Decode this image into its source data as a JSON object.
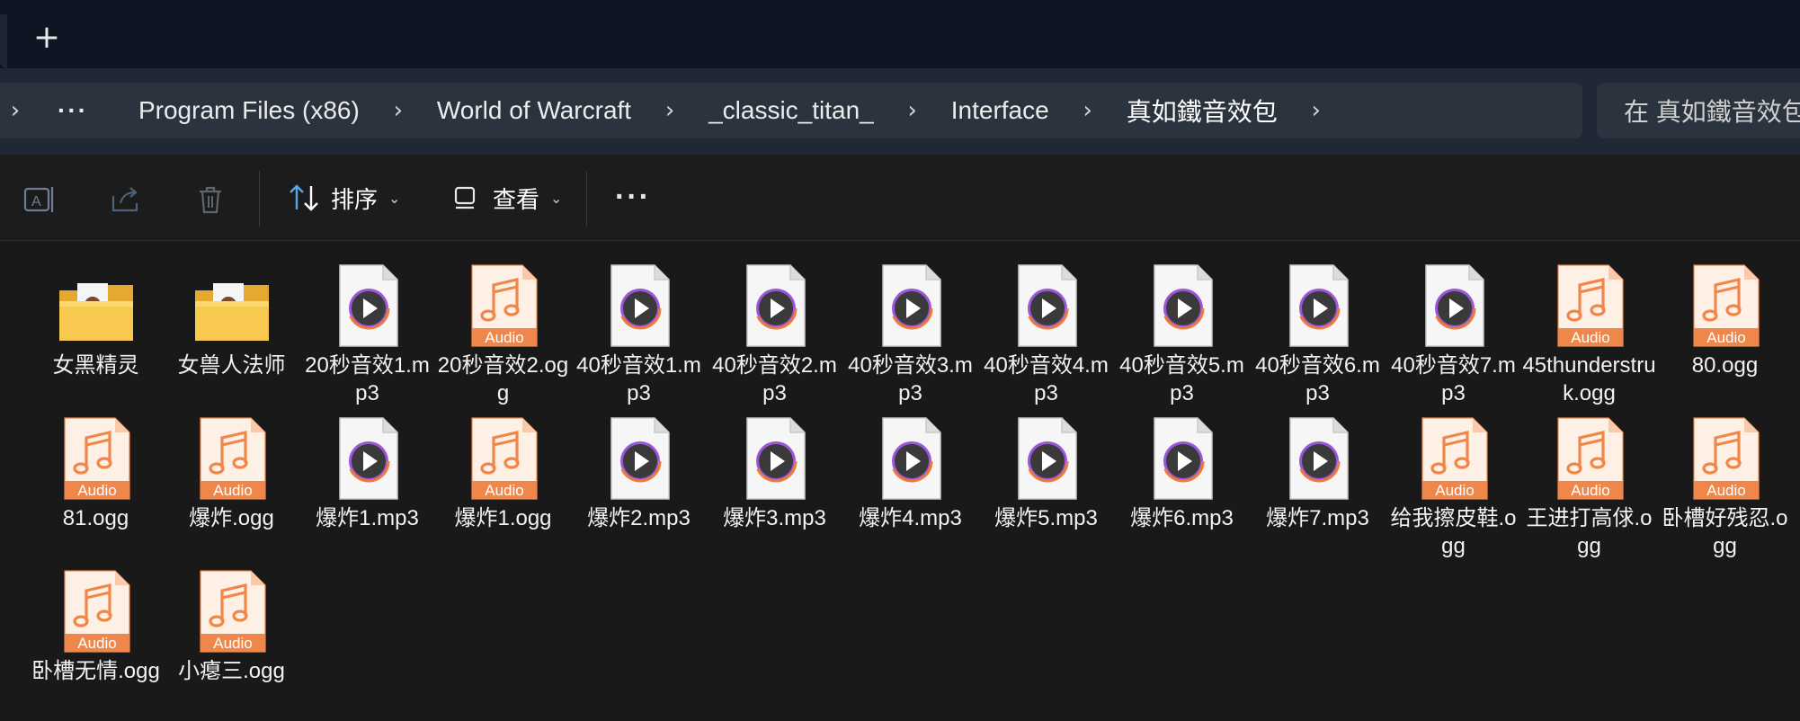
{
  "window": {
    "new_tab_glyph": "+"
  },
  "breadcrumb": {
    "more": "···",
    "items": [
      "Program Files (x86)",
      "World of Warcraft",
      "_classic_titan_",
      "Interface",
      "真如鐵音效包"
    ]
  },
  "search": {
    "placeholder": "在 真如鐵音效包"
  },
  "toolbar": {
    "sort_label": "排序",
    "view_label": "查看",
    "more_glyph": "···",
    "icons": [
      "rename-icon",
      "share-icon",
      "delete-icon",
      "sort-icon",
      "view-icon"
    ]
  },
  "files": [
    {
      "name": "女黑精灵",
      "type": "folder"
    },
    {
      "name": "女兽人法师",
      "type": "folder"
    },
    {
      "name": "20秒音效1.mp3",
      "type": "mp3"
    },
    {
      "name": "20秒音效2.ogg",
      "type": "ogg"
    },
    {
      "name": "40秒音效1.mp3",
      "type": "mp3"
    },
    {
      "name": "40秒音效2.mp3",
      "type": "mp3"
    },
    {
      "name": "40秒音效3.mp3",
      "type": "mp3"
    },
    {
      "name": "40秒音效4.mp3",
      "type": "mp3"
    },
    {
      "name": "40秒音效5.mp3",
      "type": "mp3"
    },
    {
      "name": "40秒音效6.mp3",
      "type": "mp3"
    },
    {
      "name": "40秒音效7.mp3",
      "type": "mp3"
    },
    {
      "name": "45thunderstruk.ogg",
      "type": "ogg"
    },
    {
      "name": "80.ogg",
      "type": "ogg"
    },
    {
      "name": "81.ogg",
      "type": "ogg"
    },
    {
      "name": "爆炸.ogg",
      "type": "ogg"
    },
    {
      "name": "爆炸1.mp3",
      "type": "mp3"
    },
    {
      "name": "爆炸1.ogg",
      "type": "ogg"
    },
    {
      "name": "爆炸2.mp3",
      "type": "mp3"
    },
    {
      "name": "爆炸3.mp3",
      "type": "mp3"
    },
    {
      "name": "爆炸4.mp3",
      "type": "mp3"
    },
    {
      "name": "爆炸5.mp3",
      "type": "mp3"
    },
    {
      "name": "爆炸6.mp3",
      "type": "mp3"
    },
    {
      "name": "爆炸7.mp3",
      "type": "mp3"
    },
    {
      "name": "给我擦皮鞋.ogg",
      "type": "ogg"
    },
    {
      "name": "王进打高俅.ogg",
      "type": "ogg"
    },
    {
      "name": "卧槽好残忍.ogg",
      "type": "ogg"
    },
    {
      "name": "卧槽无情.ogg",
      "type": "ogg"
    },
    {
      "name": "小瘪三.ogg",
      "type": "ogg"
    }
  ],
  "audio_badge_label": "Audio",
  "colors": {
    "background": "#191919",
    "tabstrip": "#0d1622",
    "address_bar": "#1f2834",
    "audio_orange": "#f0874a",
    "folder_yellow": "#f7c94e"
  }
}
